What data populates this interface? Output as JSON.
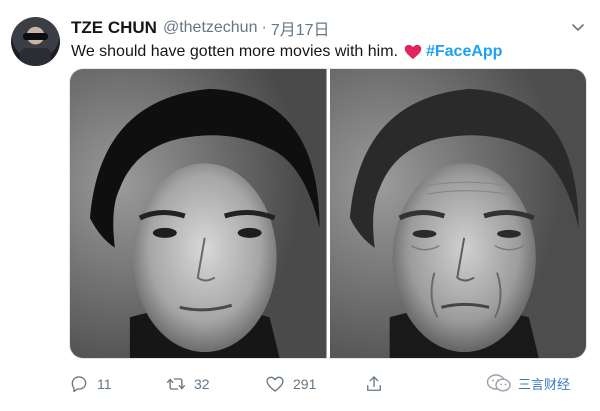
{
  "author": {
    "display_name": "TZE CHUN",
    "handle": "@thetzechun",
    "separator": "·",
    "timestamp": "7月17日"
  },
  "tweet": {
    "text": "We should have gotten more movies with him.",
    "emoji": "red-heart-icon",
    "hashtag": "#FaceApp"
  },
  "media": [
    {
      "name": "photo-young",
      "description_icon": "portrait-photo"
    },
    {
      "name": "photo-aged",
      "description_icon": "portrait-photo"
    }
  ],
  "actions": {
    "reply_count": "11",
    "retweet_count": "32",
    "like_count": "291"
  },
  "watermark": {
    "text": "三言财经"
  },
  "colors": {
    "link": "#1da1f2",
    "muted": "#657786",
    "heart": "#e0245e"
  }
}
